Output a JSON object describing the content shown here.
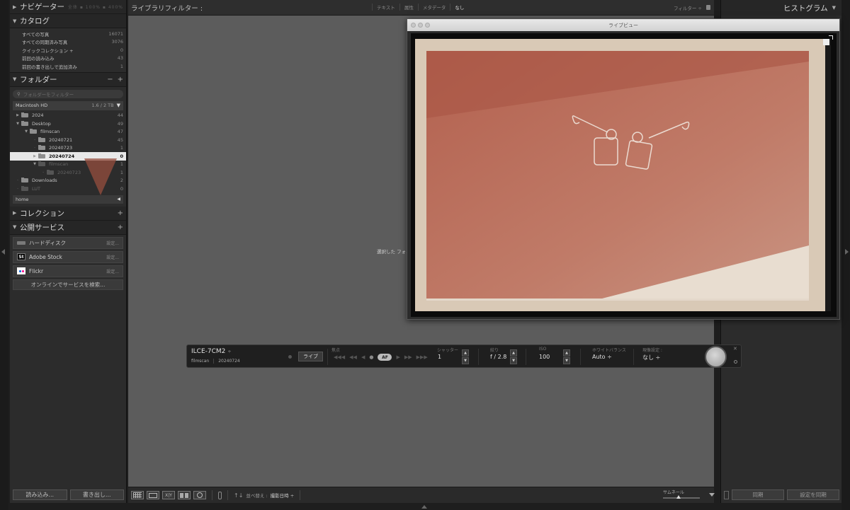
{
  "left_panel": {
    "navigator": {
      "title": "ナビゲーター",
      "opts": "全体 ▪ 100% ▪ 400%"
    },
    "catalog": {
      "title": "カタログ",
      "items": [
        {
          "label": "すべての写真",
          "count": "16071"
        },
        {
          "label": "すべての同期済み写真",
          "count": "3076"
        },
        {
          "label": "クイックコレクション +",
          "count": "0"
        },
        {
          "label": "前回の読み込み",
          "count": "43"
        },
        {
          "label": "前回の書き出しで追加済み",
          "count": "1"
        }
      ]
    },
    "folders": {
      "title": "フォルダー",
      "minus": "−",
      "plus": "+",
      "search_placeholder": "フォルダーをフィルター",
      "volume": {
        "label": "Macintosh HD",
        "size": "1.6 / 2 TB"
      },
      "items": [
        {
          "label": "2024",
          "count": "44"
        },
        {
          "label": "Desktop",
          "count": "49"
        },
        {
          "label": "filmscan",
          "count": "47"
        },
        {
          "label": "20240721",
          "count": "45"
        },
        {
          "label": "20240723",
          "count": "1"
        },
        {
          "label": "20240724",
          "count": "0"
        },
        {
          "label": "filmscan",
          "count": "1"
        },
        {
          "label": "20240723",
          "count": "1"
        },
        {
          "label": "Downloads",
          "count": "2"
        },
        {
          "label": "LUT",
          "count": "0"
        }
      ],
      "home": "home"
    },
    "collections": {
      "title": "コレクション",
      "plus": "+"
    },
    "publish": {
      "title": "公開サービス",
      "plus": "+",
      "services": [
        {
          "label": "ハードディスク",
          "setting": "設定..."
        },
        {
          "label": "Adobe Stock",
          "setting": "設定..."
        },
        {
          "label": "Flickr",
          "setting": "設定..."
        }
      ],
      "stock_icon": "St",
      "find_label": "オンラインでサービスを検索..."
    },
    "import_label": "読み込み...",
    "export_label": "書き出し..."
  },
  "filter_bar": {
    "title": "ライブラリフィルター :",
    "tabs": [
      "テキスト",
      "属性",
      "メタデータ",
      "なし"
    ],
    "preset": "フィルター ÷"
  },
  "center_message": "選択した フォ...",
  "toolbar": {
    "survey_label": "X|Y",
    "sort_label": "並べ替え :",
    "sort_value": "撮影日時 ÷",
    "thumb_label": "サムネール"
  },
  "right_panel": {
    "histogram_title": "ヒストグラム",
    "sync_label": "同期",
    "sync_settings_label": "設定を同期"
  },
  "live_view": {
    "title": "ライブビュー"
  },
  "tether": {
    "camera": "ILCE-7CM2",
    "camera_arrow": "÷",
    "session": "filmscan",
    "shot": "20240724",
    "live_label": "ライブ",
    "focus_label": "焦点",
    "af_label": "AF",
    "shutter_label": "シャッター",
    "shutter_value": "1",
    "aperture_label": "絞り",
    "aperture_value": "f / 2.8",
    "iso_label": "ISO",
    "iso_value": "100",
    "wb_label": "ホワイトバランス",
    "wb_value": "Auto ÷",
    "develop_label": "現像設定 :",
    "develop_value": "なし ÷",
    "step_up": "▲",
    "step_down": "▼",
    "close": "✕"
  }
}
